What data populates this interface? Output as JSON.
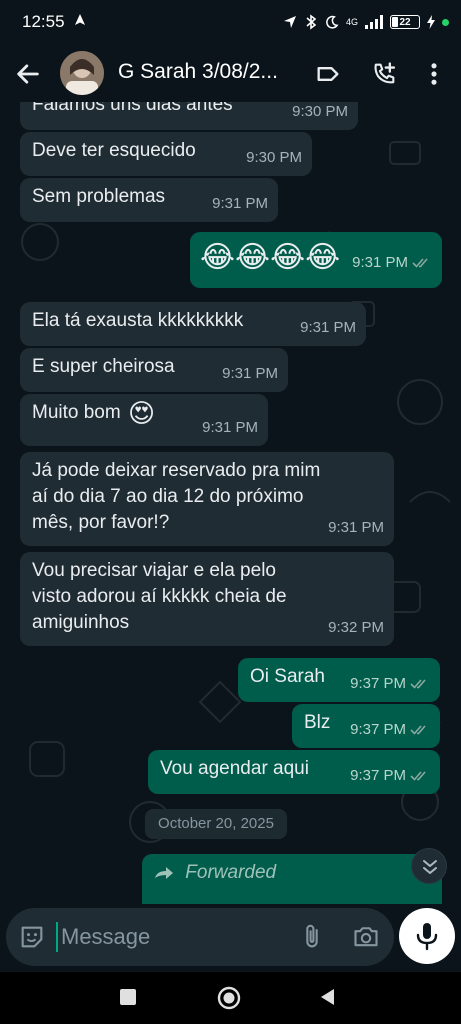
{
  "status_bar": {
    "time": "12:55",
    "network_label": "4G",
    "battery_level": "22"
  },
  "header": {
    "title": "G Sarah 3/08/2...",
    "icons": [
      "arrow-back-icon",
      "label-icon",
      "call-add-icon",
      "more-vert-icon"
    ]
  },
  "messages": [
    {
      "dir": "in",
      "text": "Falamos uns dias antes",
      "time": "9:30 PM"
    },
    {
      "dir": "in",
      "text": "Deve ter esquecido",
      "time": "9:30 PM"
    },
    {
      "dir": "in",
      "text": "Sem problemas",
      "time": "9:31 PM"
    },
    {
      "dir": "out",
      "text": "😂😂😂😂",
      "time": "9:31 PM",
      "read": true
    },
    {
      "dir": "in",
      "text": "Ela tá exausta kkkkkkkkk",
      "time": "9:31 PM"
    },
    {
      "dir": "in",
      "text": "E super cheirosa",
      "time": "9:31 PM"
    },
    {
      "dir": "in",
      "text": "Muito bom",
      "emoji": "😍",
      "time": "9:31 PM"
    },
    {
      "dir": "in",
      "lines": [
        "Já pode deixar reservado pra mim",
        "aí do dia 7 ao dia 12 do próximo",
        "mês, por favor!?"
      ],
      "time": "9:31 PM"
    },
    {
      "dir": "in",
      "lines": [
        "Vou precisar viajar e ela pelo",
        "visto adorou aí kkkkk cheia de",
        "amiguinhos"
      ],
      "time": "9:32 PM"
    },
    {
      "dir": "out",
      "text": "Oi Sarah",
      "time": "9:37 PM",
      "read": true
    },
    {
      "dir": "out",
      "text": "Blz",
      "time": "9:37 PM",
      "read": true
    },
    {
      "dir": "out",
      "text": "Vou agendar aqui",
      "time": "9:37 PM",
      "read": true
    }
  ],
  "date_separator": "October 20, 2025",
  "forwarded": {
    "label": "Forwarded"
  },
  "composer": {
    "placeholder": "Message",
    "icons": [
      "sticker-icon",
      "attach-icon",
      "camera-icon",
      "mic-icon"
    ]
  },
  "colors": {
    "background": "#0b141a",
    "incoming_bubble": "#202c33",
    "outgoing_bubble": "#005c4b",
    "accent": "#00a884",
    "tick_read": "#53bdeb"
  }
}
